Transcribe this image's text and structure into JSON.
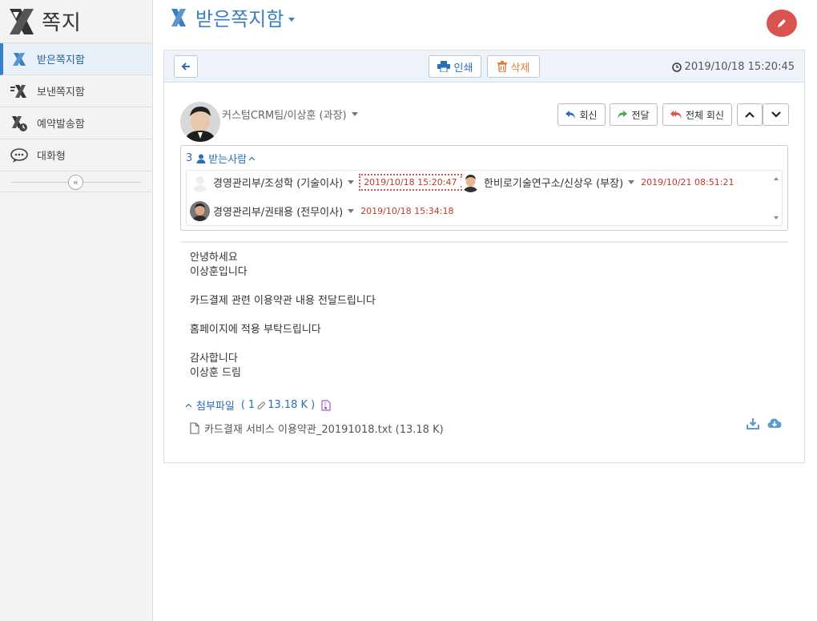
{
  "app": {
    "title": "쪽지"
  },
  "sidebar": {
    "items": [
      {
        "label": "받은쪽지함",
        "active": true,
        "icon": "inbox-note-icon"
      },
      {
        "label": "보낸쪽지함",
        "active": false,
        "icon": "sent-note-icon"
      },
      {
        "label": "예약발송함",
        "active": false,
        "icon": "scheduled-note-icon"
      },
      {
        "label": "대화형",
        "active": false,
        "icon": "chat-icon"
      }
    ],
    "collapse_glyph": "«"
  },
  "header": {
    "title": "받은쪽지함"
  },
  "toolbar": {
    "print_label": "인쇄",
    "delete_label": "삭제",
    "timestamp": "2019/10/18 15:20:45"
  },
  "message": {
    "sender": "커스텀CRM팀/이상훈 (과장)",
    "actions": {
      "reply": "회신",
      "forward": "전달",
      "reply_all": "전체 회신"
    },
    "recipients_count": "3",
    "recipients_label": "받는사람",
    "recipients": [
      {
        "name": "경영관리부/조성학 (기술이사)",
        "date": "2019/10/18 15:20:47",
        "highlight": true
      },
      {
        "name": "한비로기술연구소/신상우 (부장)",
        "date": "2019/10/21 08:51:21",
        "highlight": false
      },
      {
        "name": "경영관리부/권태용 (전무이사)",
        "date": "2019/10/18 15:34:18",
        "highlight": false
      }
    ],
    "body": "안녕하세요\n이상훈입니다\n\n카드결제 관련 이용약관 내용 전달드립니다\n\n홈페이지에 적용 부탁드립니다\n\n감사합니다\n이상훈 드림"
  },
  "attachments": {
    "label": "첨부파일",
    "count": "1",
    "size": "13.18 K",
    "files": [
      {
        "name": "카드결재 서비스 이용약관_20191018.txt (13.18 K)"
      }
    ]
  },
  "colors": {
    "accent": "#3a7fc1",
    "danger": "#d9534f",
    "date_red": "#c0392b"
  }
}
